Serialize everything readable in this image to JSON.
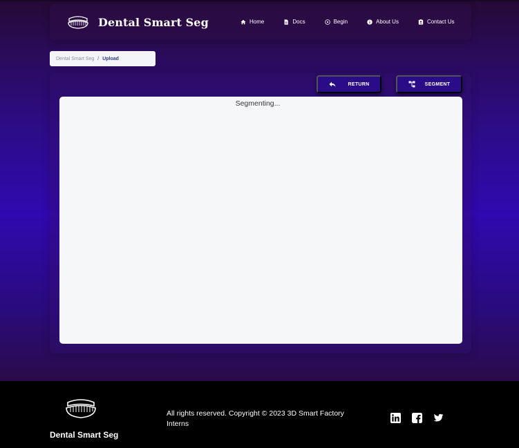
{
  "navbar": {
    "brand_name": "Dental Smart Seg",
    "brand_logo_icon": "dentures-icon",
    "links": [
      {
        "label": "Home",
        "icon": "home-icon"
      },
      {
        "label": "Docs",
        "icon": "document-icon"
      },
      {
        "label": "Begin",
        "icon": "play-circle-icon"
      },
      {
        "label": "About Us",
        "icon": "info-icon"
      },
      {
        "label": "Contact Us",
        "icon": "contact-card-icon"
      }
    ]
  },
  "breadcrumb": {
    "root": "Dental Smart Seg",
    "separator": "/",
    "current": "Upload"
  },
  "actions": {
    "return_label": "RETURN",
    "return_icon": "reply-arrow-icon",
    "segment_label": "SEGMENT",
    "segment_icon": "hierarchy-icon"
  },
  "viewer": {
    "status_text": "Segmenting..."
  },
  "footer": {
    "brand_name": "Dental Smart Seg",
    "logo_icon": "dentures-icon",
    "copyright": "All rights reserved. Copyright © 2023 3D Smart Factory Interns",
    "socials": [
      "linkedin-icon",
      "facebook-icon",
      "twitter-icon"
    ]
  },
  "colors": {
    "accent": "#2a0c88",
    "panel_bg": "#f6f7f9",
    "footer_bg": "#000000"
  }
}
